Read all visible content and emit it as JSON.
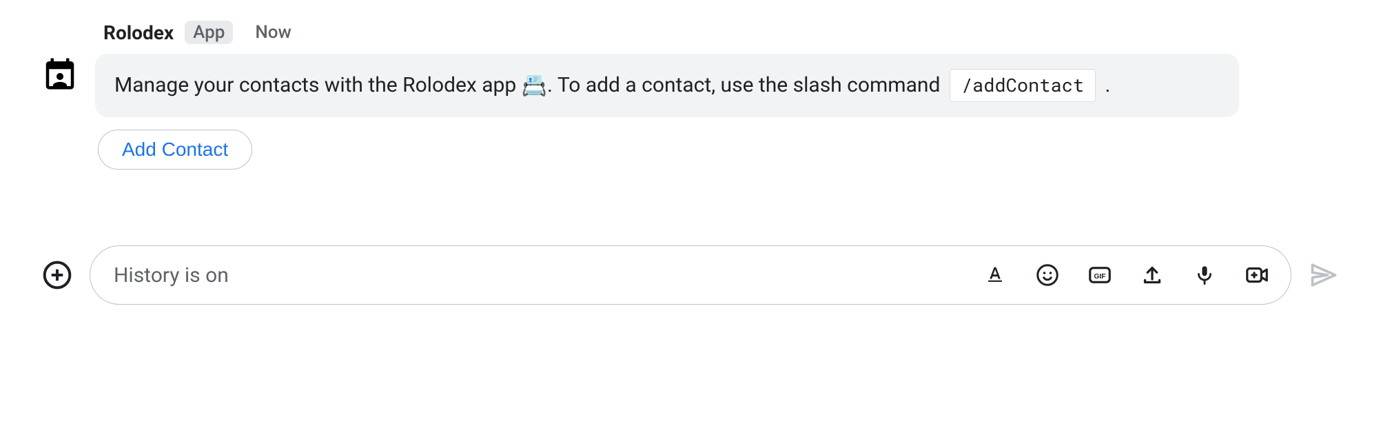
{
  "message": {
    "sender": "Rolodex",
    "badge": "App",
    "timestamp": "Now",
    "body_part1": "Manage your contacts with the Rolodex app ",
    "body_emoji": "📇",
    "body_part2": ". To add a contact, use the slash command ",
    "slash_command": "/addContact",
    "body_part3": " ."
  },
  "actions": {
    "add_contact_label": "Add Contact"
  },
  "compose": {
    "placeholder": "History is on"
  }
}
